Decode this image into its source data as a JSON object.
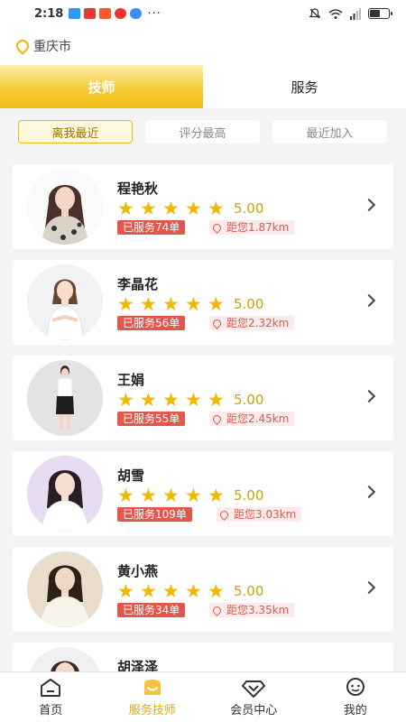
{
  "status_bar": {
    "time": "2:18",
    "dots": "···"
  },
  "location": {
    "city": "重庆市"
  },
  "tabs": [
    {
      "label": "技师",
      "active": true
    },
    {
      "label": "服务",
      "active": false
    }
  ],
  "filters": [
    {
      "label": "离我最近",
      "active": true
    },
    {
      "label": "评分最高",
      "active": false
    },
    {
      "label": "最近加入",
      "active": false
    }
  ],
  "technicians": [
    {
      "name": "程艳秋",
      "stars": 5,
      "rating": "5.00",
      "served": "已服务74单",
      "distance": "距您1.87km"
    },
    {
      "name": "李晶花",
      "stars": 5,
      "rating": "5.00",
      "served": "已服务56单",
      "distance": "距您2.32km"
    },
    {
      "name": "王娟",
      "stars": 5,
      "rating": "5.00",
      "served": "已服务55单",
      "distance": "距您2.45km"
    },
    {
      "name": "胡雪",
      "stars": 5,
      "rating": "5.00",
      "served": "已服务109单",
      "distance": "距您3.03km"
    },
    {
      "name": "黄小燕",
      "stars": 5,
      "rating": "5.00",
      "served": "已服务34单",
      "distance": "距您3.35km"
    },
    {
      "name": "胡泽泽"
    }
  ],
  "bottom_nav": [
    {
      "label": "首页",
      "icon": "home-icon",
      "active": false
    },
    {
      "label": "服务技师",
      "icon": "technician-icon",
      "active": true
    },
    {
      "label": "会员中心",
      "icon": "member-diamond-icon",
      "active": false
    },
    {
      "label": "我的",
      "icon": "profile-icon",
      "active": false
    }
  ],
  "colors": {
    "accent": "#f1bd13",
    "tag_red": "#e1574b",
    "star": "#f0b800"
  }
}
